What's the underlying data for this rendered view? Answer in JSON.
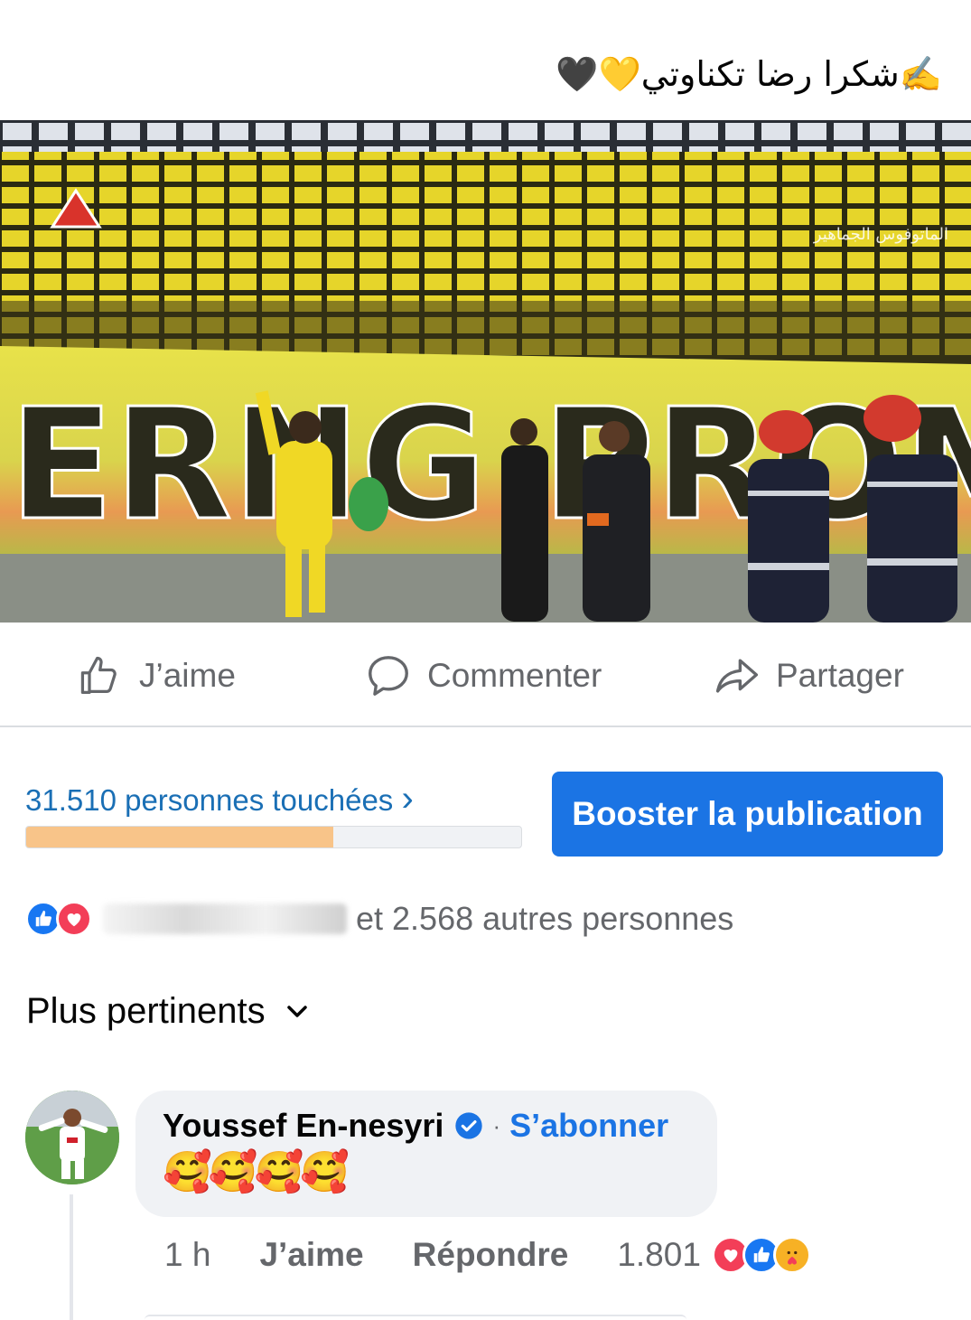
{
  "post": {
    "caption": "✍️شكرا رضا تكناوتي",
    "caption_hearts": "🖤💛"
  },
  "photo": {
    "banner_fragments": [
      "ERNG",
      "PROM"
    ],
    "stand_text": "الماتوفوس الجماهير"
  },
  "actions": {
    "like": "J’aime",
    "comment": "Commenter",
    "share": "Partager"
  },
  "insights": {
    "reach_text": "31.510 personnes touchées",
    "reach_chevron": "›",
    "reach_progress": 0.62,
    "boost_label": "Booster la publication"
  },
  "reactions": {
    "summary": "et 2.568 autres personnes"
  },
  "comments_sort": {
    "label": "Plus pertinents"
  },
  "comment": {
    "author": "Youssef En-nesyri",
    "separator": "·",
    "follow_label": "S’abonner",
    "body": "🥰🥰🥰🥰",
    "time": "1 h",
    "like_label": "J’aime",
    "reply_label": "Répondre",
    "reaction_count": "1.801"
  },
  "colors": {
    "accent": "#1b74e4",
    "link": "#1a6fb5",
    "muted": "#65676b",
    "progress_fill": "#f8c489",
    "love": "#f33e58",
    "like": "#1877f2"
  }
}
